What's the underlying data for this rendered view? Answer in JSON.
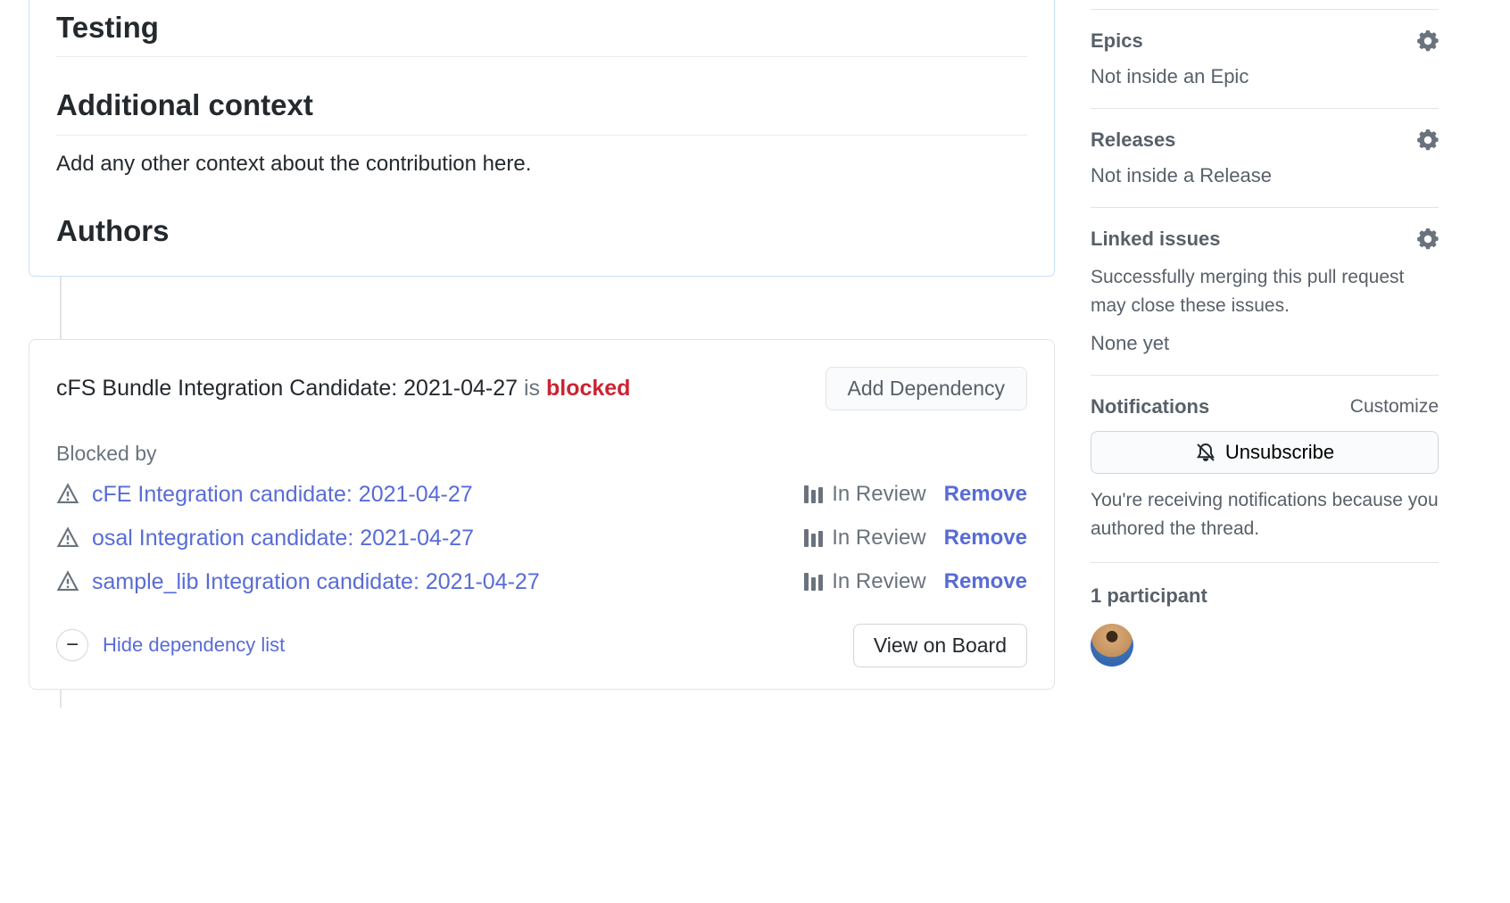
{
  "content": {
    "heading_testing": "Testing",
    "heading_additional": "Additional context",
    "additional_text": "Add any other context about the contribution here.",
    "heading_authors": "Authors"
  },
  "dependency": {
    "title_prefix": "cFS Bundle Integration Candidate: 2021-04-27",
    "is": " is ",
    "status": "blocked",
    "add_btn": "Add Dependency",
    "blocked_by_label": "Blocked by",
    "items": [
      {
        "link": "cFE Integration candidate: 2021-04-27",
        "status": "In Review",
        "remove": "Remove"
      },
      {
        "link": "osal Integration candidate: 2021-04-27",
        "status": "In Review",
        "remove": "Remove"
      },
      {
        "link": "sample_lib Integration candidate: 2021-04-27",
        "status": "In Review",
        "remove": "Remove"
      }
    ],
    "hide_label": "Hide dependency list",
    "view_board_btn": "View on Board"
  },
  "sidebar": {
    "epics": {
      "title": "Epics",
      "value": "Not inside an Epic"
    },
    "releases": {
      "title": "Releases",
      "value": "Not inside a Release"
    },
    "linked_issues": {
      "title": "Linked issues",
      "subtext": "Successfully merging this pull request may close these issues.",
      "value": "None yet"
    },
    "notifications": {
      "title": "Notifications",
      "customize": "Customize",
      "unsubscribe": "Unsubscribe",
      "reason": "You're receiving notifications because you authored the thread."
    },
    "participants": {
      "title": "1 participant"
    }
  }
}
